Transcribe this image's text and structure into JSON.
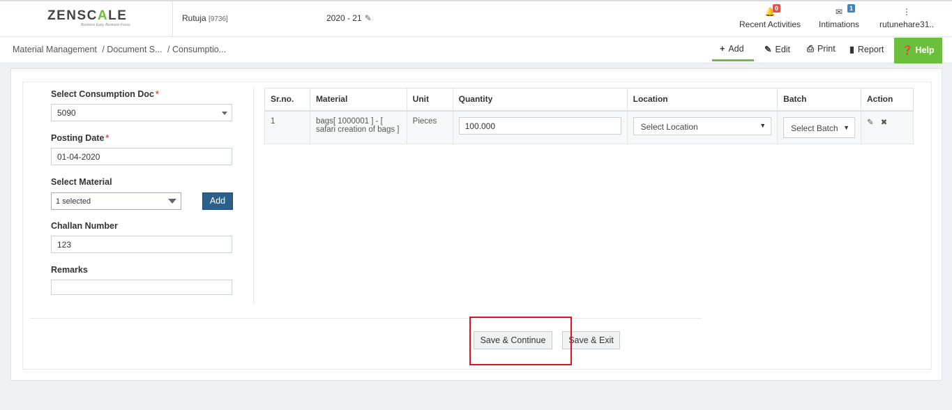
{
  "header": {
    "logo_prefix": "ZENSC",
    "logo_highlight": "A",
    "logo_suffix": "LE",
    "logo_tagline": "Business Easy. Business Focus.",
    "user_name": "Rutuja",
    "user_id": "[9736]",
    "financial_year": "2020 - 21",
    "recent_activities_label": "Recent Activities",
    "recent_activities_count": "0",
    "intimations_label": "Intimations",
    "intimations_count": "1",
    "account_label": "rutunehare31.."
  },
  "breadcrumb": {
    "item1": "Material Management",
    "item2": "/ Document S...",
    "item3": "/ Consumptio..."
  },
  "actions": {
    "add": "Add",
    "edit": "Edit",
    "print": "Print",
    "report": "Report",
    "help": "Help"
  },
  "form": {
    "consumption_doc_label": "Select Consumption Doc",
    "consumption_doc_value": "5090",
    "posting_date_label": "Posting Date",
    "posting_date_value": "01-04-2020",
    "material_label": "Select Material",
    "material_value": "1 selected",
    "add_button": "Add",
    "challan_label": "Challan Number",
    "challan_value": "123",
    "remarks_label": "Remarks",
    "remarks_value": "",
    "required_mark": "*"
  },
  "table": {
    "headers": [
      "Sr.no.",
      "Material",
      "Unit",
      "Quantity",
      "Location",
      "Batch",
      "Action"
    ],
    "rows": [
      {
        "srno": "1",
        "material": "bags[ 1000001 ] - [ safari creation of bags ]",
        "unit": "Pieces",
        "quantity": "100.000",
        "location": "Select Location",
        "batch": "Select Batch"
      }
    ]
  },
  "footer": {
    "save_continue": "Save & Continue",
    "save_exit": "Save & Exit"
  },
  "colors": {
    "accent_green": "#6cbf3d",
    "primary_blue": "#2b5f8c",
    "highlight_red": "#e0141e"
  }
}
